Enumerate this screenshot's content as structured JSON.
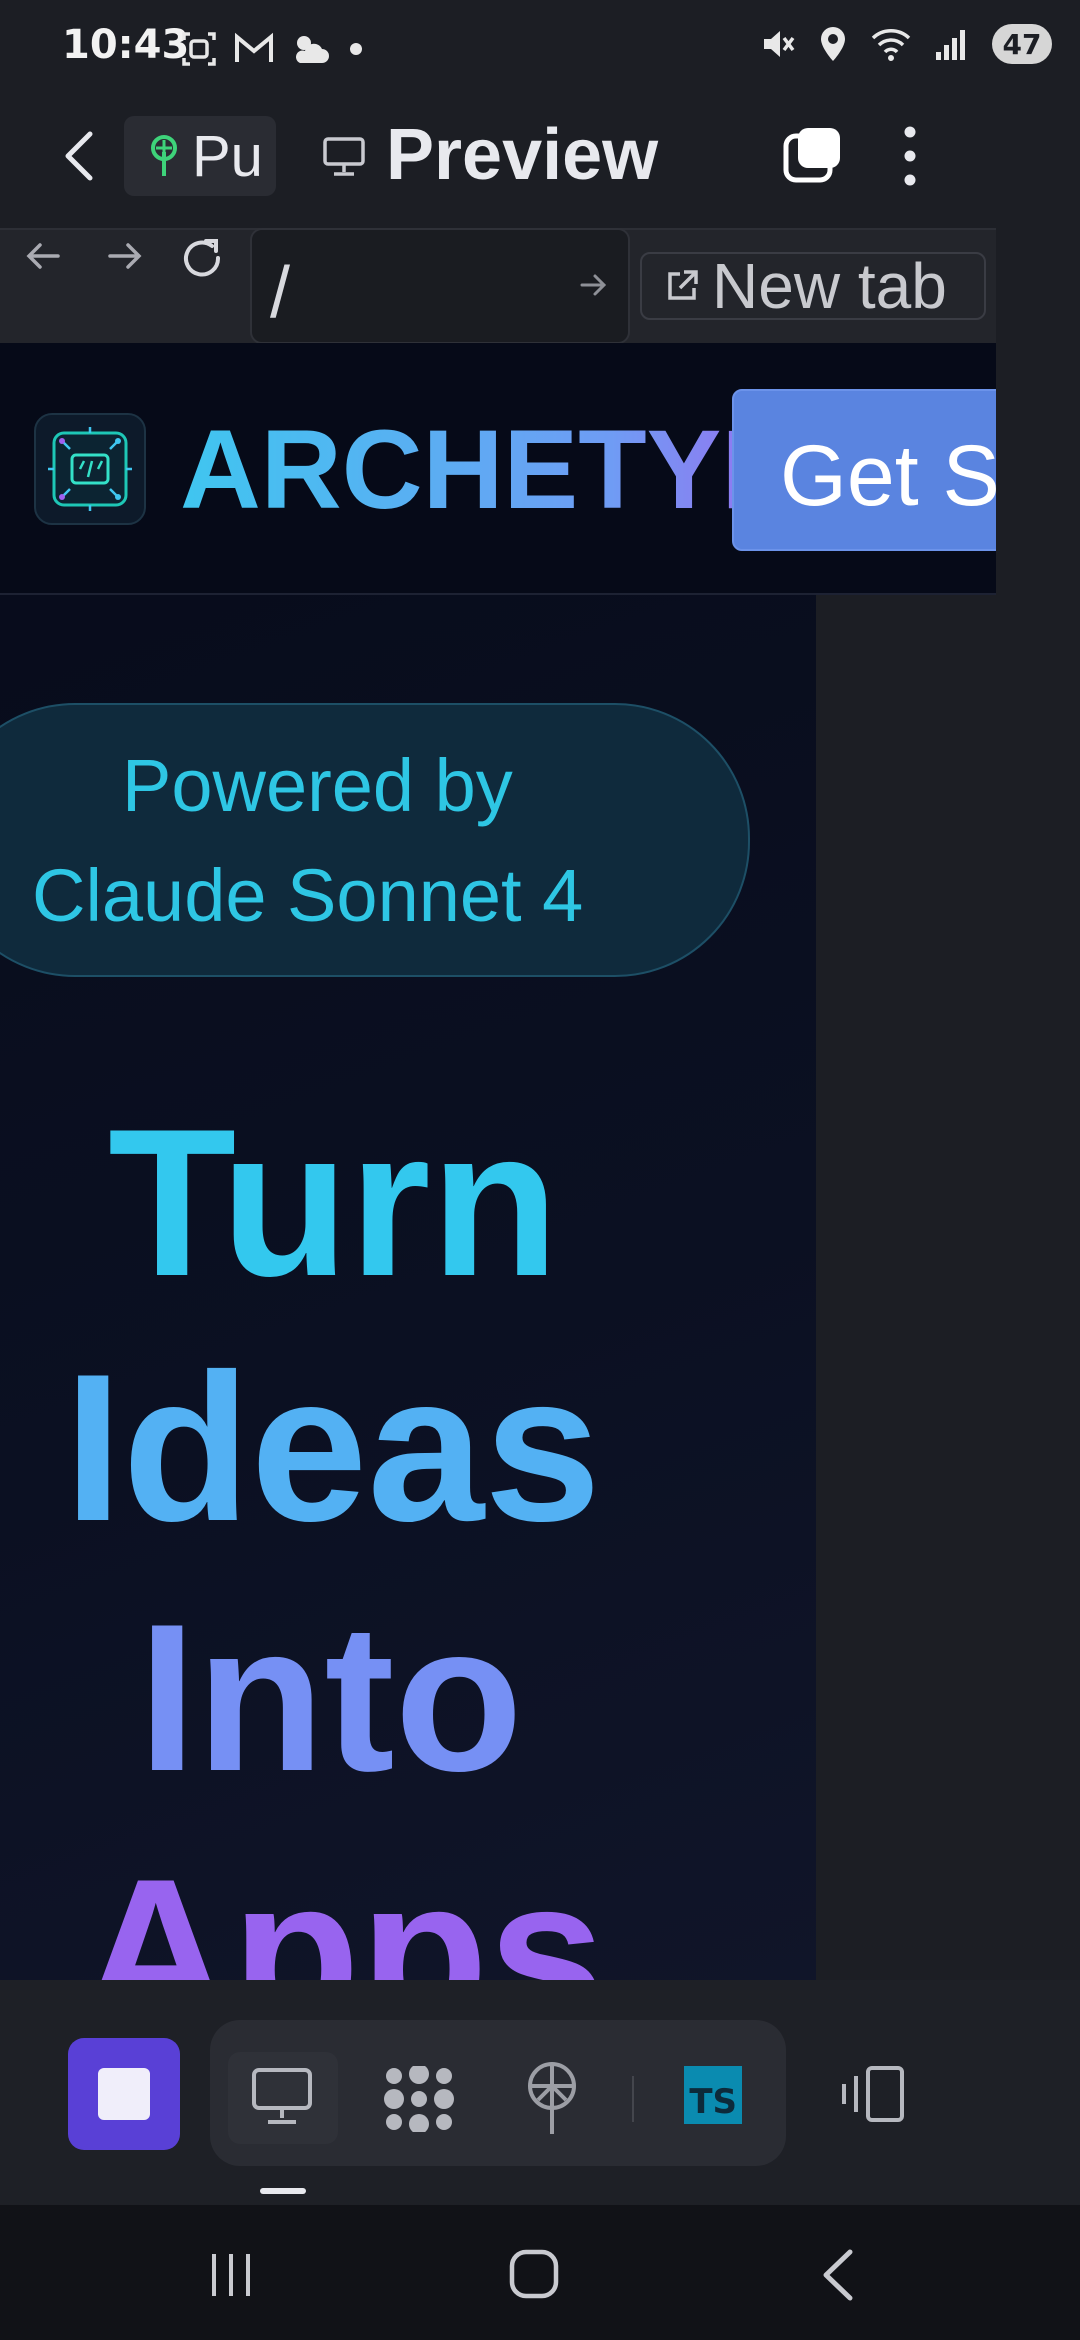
{
  "status_bar": {
    "time": "10:43",
    "left_icons": [
      "screenshot-icon",
      "gmail-icon",
      "weather-icon",
      "dot-icon"
    ],
    "right_icons": [
      "mute-icon",
      "location-icon",
      "wifi-icon",
      "signal-icon"
    ],
    "battery": "47"
  },
  "app_bar": {
    "chip_label": "Pu",
    "title": "Preview"
  },
  "browser": {
    "url": "/",
    "new_tab_label": "New tab"
  },
  "site": {
    "brand": "ARCHETYP",
    "cta_label": "Get St",
    "badge_line1": "Powered by",
    "badge_line2": "Claude Sonnet 4",
    "hero_words": [
      "Turn",
      "Ideas",
      "Into",
      "Apps"
    ],
    "colors": {
      "brand_start": "#3fc6f0",
      "brand_end": "#9b6cf0",
      "cta": "#5a84e0",
      "badge_text": "#2ec6e4"
    }
  },
  "toolbar": {
    "ts_label": "TS",
    "tools": [
      "stop-icon",
      "monitor-icon",
      "grid-dots-icon",
      "deploy-icon",
      "typescript-icon",
      "device-layout-icon"
    ]
  }
}
